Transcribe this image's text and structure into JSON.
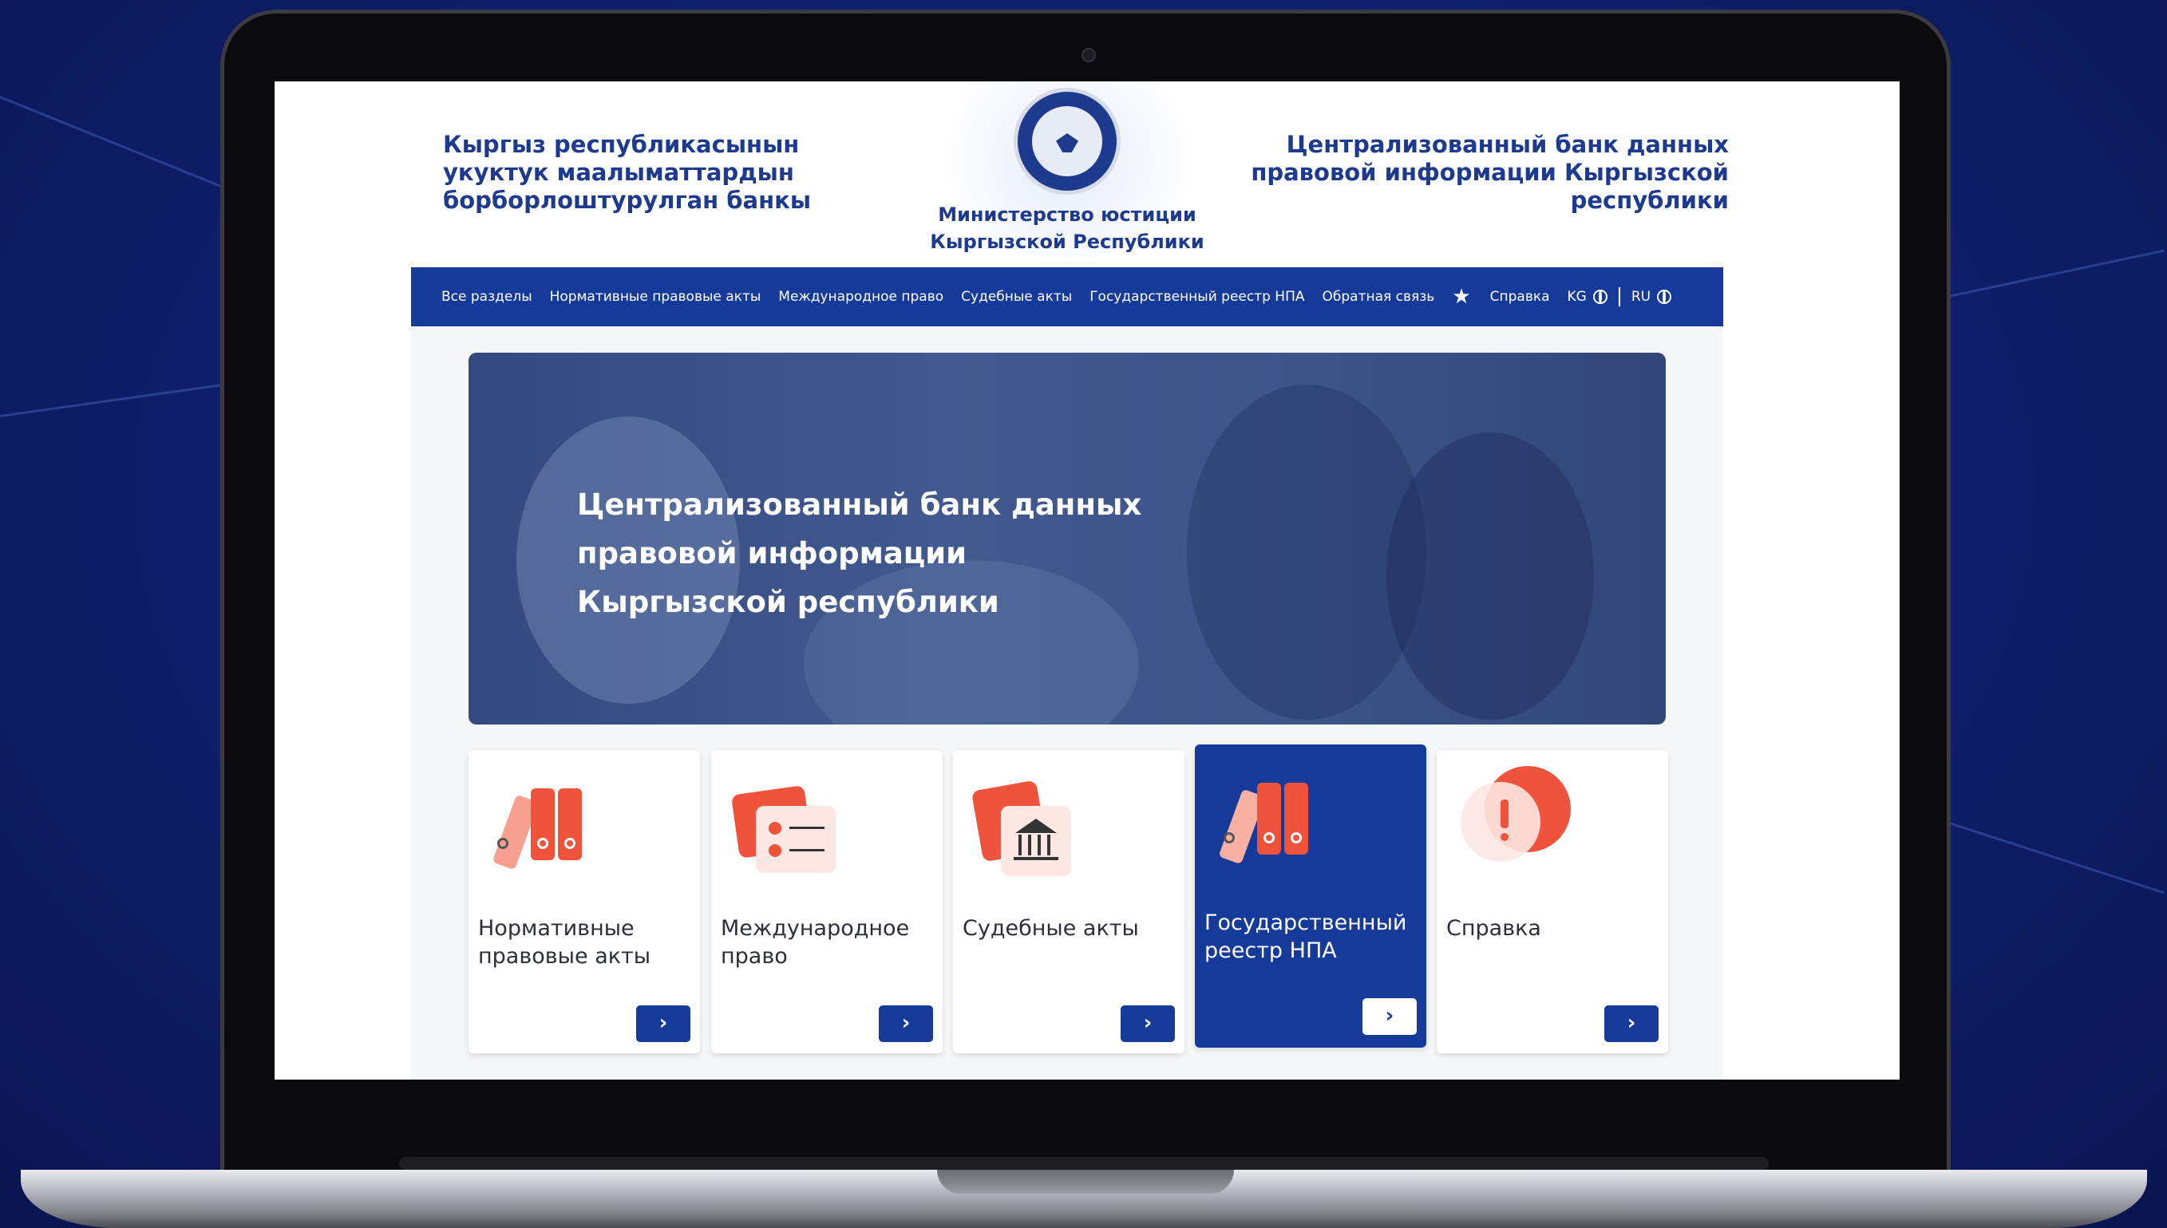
{
  "colors": {
    "primary": "#153a9a",
    "header_text": "#1d3a8f",
    "accent": "#f0533b",
    "background": "#0f1f6b"
  },
  "header": {
    "left_title": "Кыргыз республикасынын укуктук маалыматтардын борборлоштурулган банкы",
    "right_title": "Централизованный банк данных правовой информации Кыргызской республики",
    "ministry": "Министерство юстиции Кыргызской Республики"
  },
  "nav": {
    "items": [
      {
        "label": "Все разделы"
      },
      {
        "label": "Нормативные правовые акты"
      },
      {
        "label": "Международное право"
      },
      {
        "label": "Судебные акты"
      },
      {
        "label": "Государственный реестр НПА"
      },
      {
        "label": "Обратная связь"
      },
      {
        "label": "Справка"
      }
    ],
    "favorites_icon": "star-icon",
    "lang_kg": "KG",
    "lang_ru": "RU",
    "lang_icon": "globe-icon"
  },
  "hero": {
    "line1": "Централизованный банк данных",
    "line2": "правовой информации",
    "line3": "Кыргызской республики"
  },
  "cards": [
    {
      "label": "Нормативные правовые акты",
      "icon": "binders-icon",
      "arrow": "›",
      "active": false
    },
    {
      "label": "Международное право",
      "icon": "checklist-icon",
      "arrow": "›",
      "active": false
    },
    {
      "label": "Судебные акты",
      "icon": "courthouse-icon",
      "arrow": "›",
      "active": false
    },
    {
      "label": "Государственный реестр НПА",
      "icon": "binders-icon",
      "arrow": "›",
      "active": true
    },
    {
      "label": "Справка",
      "icon": "exclamation-icon",
      "arrow": "›",
      "active": false
    }
  ]
}
